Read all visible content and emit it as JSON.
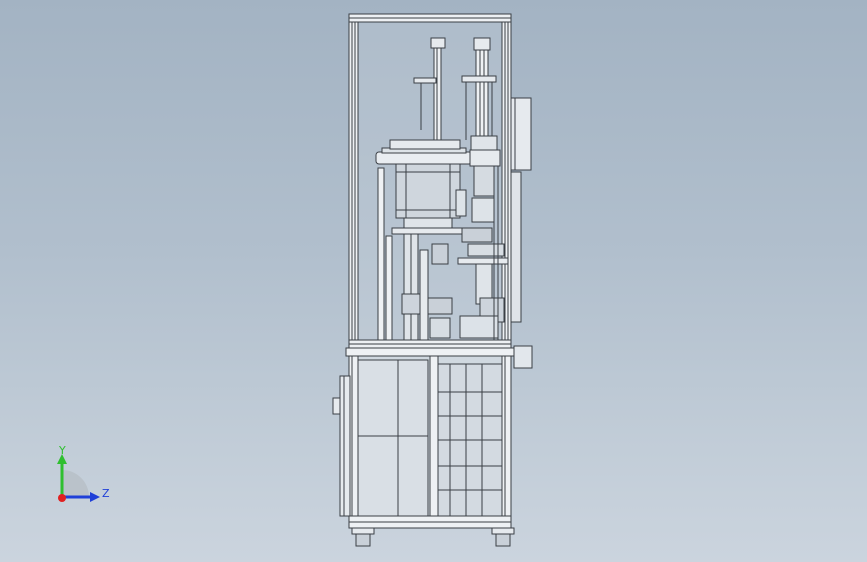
{
  "viewport": {
    "background_top": "#a3b3c3",
    "background_bottom": "#cbd4de"
  },
  "triad": {
    "y_label": "Y",
    "z_label": "Z",
    "y_color": "#2fbf2f",
    "z_color": "#1f3fd8",
    "x_color": "#e02020"
  },
  "model": {
    "line_color": "#3a3f45",
    "frame_color": "#eef1f4",
    "body_color": "#dfe4e9"
  }
}
